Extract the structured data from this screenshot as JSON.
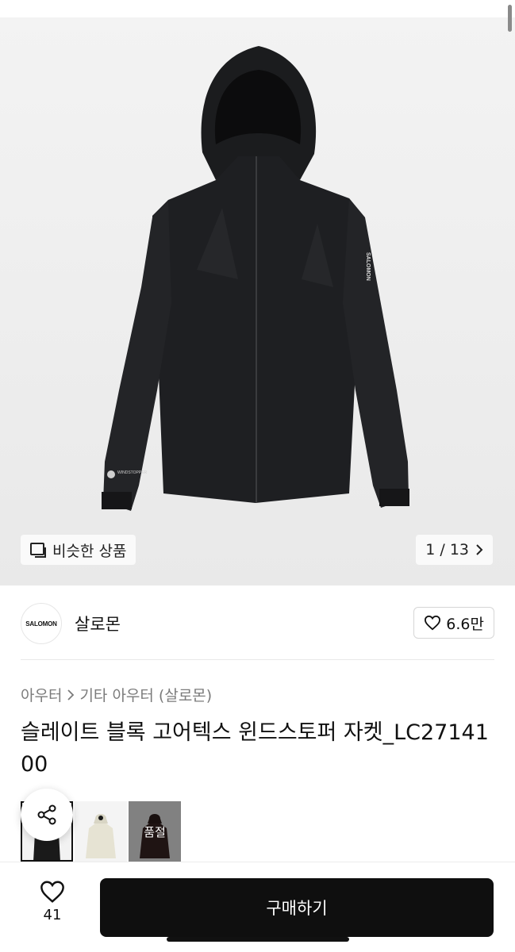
{
  "gallery": {
    "similar_label": "비슷한 상품",
    "pager": {
      "current": "1",
      "separator": "/",
      "total": "13",
      "text": "1 / 13"
    },
    "sleeve_brand_text": "SALOMON",
    "cuff_logo_text": "WINDSTOPPER"
  },
  "brand": {
    "logo_text": "SALOMON",
    "name": "살로몬",
    "likes": "6.6만"
  },
  "breadcrumb": {
    "level1": "아우터",
    "level2": "기타 아우터 (살로몬)"
  },
  "product": {
    "title": "슬레이트 블록 고어텍스 윈드스토퍼 자켓_LC2714100"
  },
  "thumbnails": {
    "soldout_label": "품절",
    "colors": [
      "#1a1a1a",
      "#e6e3d3",
      "#3a2624"
    ]
  },
  "bottom_bar": {
    "wish_count": "41",
    "buy_label": "구매하기"
  },
  "icons": {
    "similar": "similar-items-icon",
    "chevron": "chevron-right-icon",
    "heart": "heart-icon",
    "share": "share-icon"
  }
}
